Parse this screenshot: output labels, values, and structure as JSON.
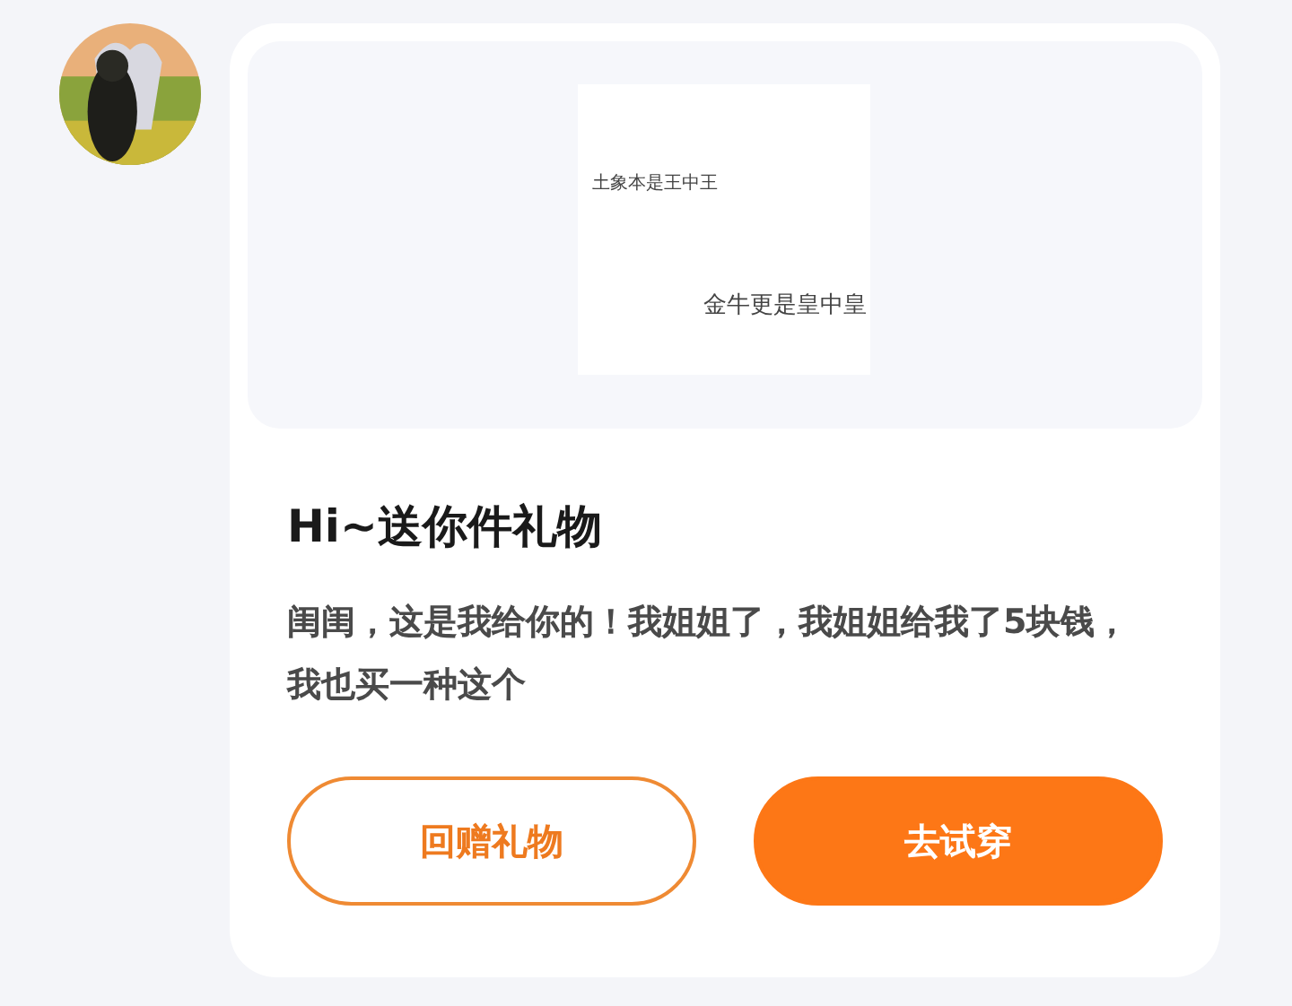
{
  "gift_preview": {
    "lines": [
      "土象本是王中王",
      "金牛更是皇中皇"
    ]
  },
  "title": "Hi~送你件礼物",
  "message": "闺闺，这是我给你的！我姐姐了，我姐姐给我了5块钱，我也买一种这个",
  "buttons": [
    {
      "label": "回赠礼物",
      "kind": "outline"
    },
    {
      "label": "去试穿",
      "kind": "filled"
    }
  ]
}
